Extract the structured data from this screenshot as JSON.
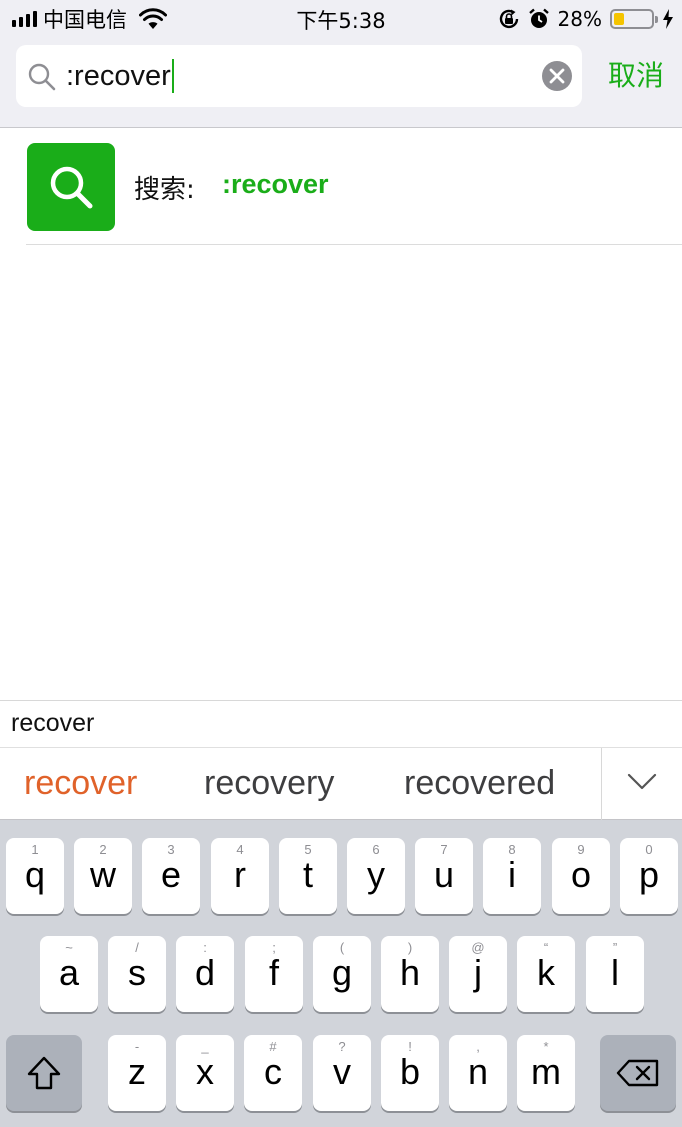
{
  "status_bar": {
    "carrier": "中国电信",
    "time": "下午5:38",
    "battery_percent": "28%",
    "battery_level": 0.28,
    "icons": [
      "signal-icon",
      "wifi-icon",
      "orientation-lock-icon",
      "alarm-icon",
      "battery-icon",
      "charging-icon"
    ]
  },
  "search": {
    "query": ":recover",
    "cancel_label": "取消",
    "icons": [
      "search-icon",
      "clear-icon"
    ]
  },
  "result": {
    "label": "搜索:",
    "query": ":recover",
    "icon": "search-icon",
    "accent_color": "#1aad19"
  },
  "keyboard": {
    "candidate": "recover",
    "suggestions": [
      "recover",
      "recovery",
      "recovered"
    ],
    "active_suggestion_color": "#e0622a",
    "rows": [
      [
        {
          "ch": "q",
          "hint": "1"
        },
        {
          "ch": "w",
          "hint": "2"
        },
        {
          "ch": "e",
          "hint": "3"
        },
        {
          "ch": "r",
          "hint": "4"
        },
        {
          "ch": "t",
          "hint": "5"
        },
        {
          "ch": "y",
          "hint": "6"
        },
        {
          "ch": "u",
          "hint": "7"
        },
        {
          "ch": "i",
          "hint": "8"
        },
        {
          "ch": "o",
          "hint": "9"
        },
        {
          "ch": "p",
          "hint": "0"
        }
      ],
      [
        {
          "ch": "a",
          "hint": "~"
        },
        {
          "ch": "s",
          "hint": "/"
        },
        {
          "ch": "d",
          "hint": ":"
        },
        {
          "ch": "f",
          "hint": ";"
        },
        {
          "ch": "g",
          "hint": "("
        },
        {
          "ch": "h",
          "hint": ")"
        },
        {
          "ch": "j",
          "hint": "@"
        },
        {
          "ch": "k",
          "hint": "“"
        },
        {
          "ch": "l",
          "hint": "”"
        }
      ],
      [
        {
          "ch": "z",
          "hint": "-"
        },
        {
          "ch": "x",
          "hint": "_"
        },
        {
          "ch": "c",
          "hint": "#"
        },
        {
          "ch": "v",
          "hint": "?"
        },
        {
          "ch": "b",
          "hint": "!"
        },
        {
          "ch": "n",
          "hint": ","
        },
        {
          "ch": "m",
          "hint": "*"
        }
      ]
    ],
    "icons": [
      "shift-icon",
      "backspace-icon",
      "chevron-down-icon"
    ]
  }
}
